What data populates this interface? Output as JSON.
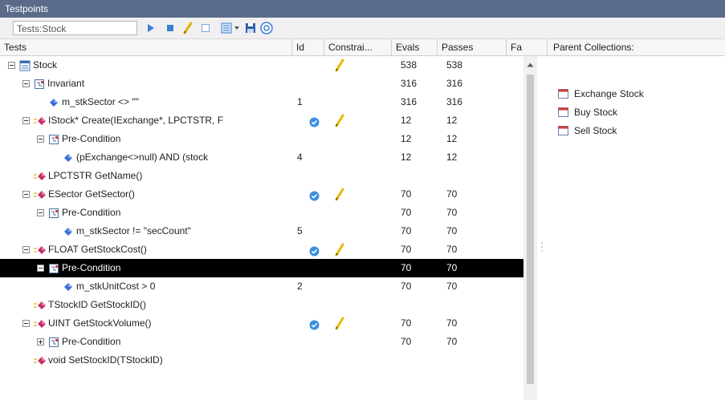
{
  "title": "Testpoints",
  "toolbar": {
    "search_value": "Tests:Stock",
    "icons": [
      "run-icon",
      "stop-icon",
      "edit-icon",
      "checkbox-icon",
      "report-icon",
      "dropdown-icon",
      "save-icon",
      "options-icon"
    ]
  },
  "columns": {
    "tests": "Tests",
    "id": "Id",
    "constraints": "Constrai...",
    "evals": "Evals",
    "passes": "Passes",
    "fails": "Fa"
  },
  "right_header": "Parent Collections:",
  "collections": [
    "Exchange Stock",
    "Buy Stock",
    "Sell Stock"
  ],
  "rows": [
    {
      "name": "Stock",
      "level": 0,
      "expander": "minus",
      "icon": "class",
      "id": "",
      "check": false,
      "pencil": true,
      "evals": "538",
      "passes": "538"
    },
    {
      "name": "Invariant",
      "level": 1,
      "expander": "minus",
      "icon": "constraint-group",
      "id": "",
      "check": false,
      "pencil": false,
      "evals": "316",
      "passes": "316"
    },
    {
      "name": "m_stkSector <> \"\"",
      "level": 2,
      "expander": "none",
      "icon": "diamond",
      "id": "1",
      "check": false,
      "pencil": false,
      "evals": "316",
      "passes": "316"
    },
    {
      "name": "IStock* Create(IExchange*, LPCTSTR, F",
      "level": 1,
      "expander": "minus",
      "icon": "method",
      "id": "",
      "check": true,
      "pencil": true,
      "evals": "12",
      "passes": "12"
    },
    {
      "name": "Pre-Condition",
      "level": 2,
      "expander": "minus",
      "icon": "constraint-group",
      "id": "",
      "check": false,
      "pencil": false,
      "evals": "12",
      "passes": "12"
    },
    {
      "name": "(pExchange<>null) AND (stock",
      "level": 3,
      "expander": "none",
      "icon": "diamond",
      "id": "4",
      "check": false,
      "pencil": false,
      "evals": "12",
      "passes": "12"
    },
    {
      "name": "LPCTSTR GetName()",
      "level": 1,
      "expander": "none",
      "icon": "method",
      "id": "",
      "check": false,
      "pencil": false,
      "evals": "",
      "passes": ""
    },
    {
      "name": "ESector GetSector()",
      "level": 1,
      "expander": "minus",
      "icon": "method",
      "id": "",
      "check": true,
      "pencil": true,
      "evals": "70",
      "passes": "70"
    },
    {
      "name": "Pre-Condition",
      "level": 2,
      "expander": "minus",
      "icon": "constraint-group",
      "id": "",
      "check": false,
      "pencil": false,
      "evals": "70",
      "passes": "70"
    },
    {
      "name": "m_stkSector != \"secCount\"",
      "level": 3,
      "expander": "none",
      "icon": "diamond",
      "id": "5",
      "check": false,
      "pencil": false,
      "evals": "70",
      "passes": "70"
    },
    {
      "name": "FLOAT GetStockCost()",
      "level": 1,
      "expander": "minus",
      "icon": "method",
      "id": "",
      "check": true,
      "pencil": true,
      "evals": "70",
      "passes": "70"
    },
    {
      "name": "Pre-Condition",
      "level": 2,
      "expander": "minus",
      "icon": "constraint-group",
      "id": "",
      "check": false,
      "pencil": false,
      "evals": "70",
      "passes": "70",
      "selected": true
    },
    {
      "name": "m_stkUnitCost > 0",
      "level": 3,
      "expander": "none",
      "icon": "diamond",
      "id": "2",
      "check": false,
      "pencil": false,
      "evals": "70",
      "passes": "70"
    },
    {
      "name": "TStockID GetStockID()",
      "level": 1,
      "expander": "none",
      "icon": "method",
      "id": "",
      "check": false,
      "pencil": false,
      "evals": "",
      "passes": ""
    },
    {
      "name": "UINT GetStockVolume()",
      "level": 1,
      "expander": "minus",
      "icon": "method",
      "id": "",
      "check": true,
      "pencil": true,
      "evals": "70",
      "passes": "70"
    },
    {
      "name": "Pre-Condition",
      "level": 2,
      "expander": "plus",
      "icon": "constraint-group",
      "id": "",
      "check": false,
      "pencil": false,
      "evals": "70",
      "passes": "70"
    },
    {
      "name": "void SetStockID(TStockID)",
      "level": 1,
      "expander": "none",
      "icon": "method",
      "id": "",
      "check": false,
      "pencil": false,
      "evals": "",
      "passes": ""
    }
  ]
}
